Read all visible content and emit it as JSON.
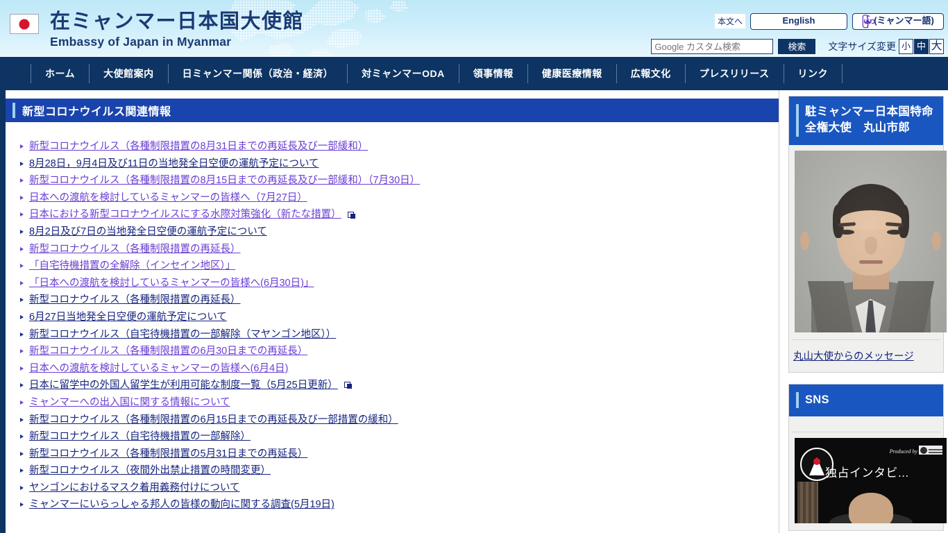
{
  "header": {
    "title_jp": "在ミャンマー日本国大使館",
    "title_en": "Embassy of Japan in Myanmar",
    "flag_icon": "japan-flag-icon",
    "skip_link": "本文へ",
    "lang_english": "English",
    "lang_myanmar_native": "မြန်မာ",
    "lang_myanmar_jp": "(ミャンマー語)",
    "search_placeholder": "Google カスタム検索",
    "search_value": "",
    "search_button": "検索",
    "fontsize_label": "文字サイズ変更",
    "fontsize_options": [
      "小",
      "中",
      "大"
    ],
    "fontsize_selected": "中",
    "bg_gradient_top": "#bfe8f7",
    "bg_gradient_bottom": "#e8f7fd",
    "title_color": "#1b3a73"
  },
  "nav": {
    "bg_color": "#0d3462",
    "items": [
      {
        "label": "ホーム"
      },
      {
        "label": "大使館案内"
      },
      {
        "label": "日ミャンマー関係（政治・経済）"
      },
      {
        "label": "対ミャンマーODA"
      },
      {
        "label": "領事情報"
      },
      {
        "label": "健康医療情報"
      },
      {
        "label": "広報文化"
      },
      {
        "label": "プレスリリース"
      },
      {
        "label": "リンク"
      }
    ]
  },
  "main": {
    "heading": "新型コロナウイルス関連情報",
    "heading_bg": "#1a44ad",
    "heading_accent": "#9fd2f2",
    "links": [
      {
        "label": "新型コロナウイルス（各種制限措置の8月31日までの再延長及び一部緩和）",
        "style": "unvisited",
        "external": false
      },
      {
        "label": "8月28日，9月4日及び11日の当地発全日空便の運航予定について",
        "style": "visited",
        "external": false
      },
      {
        "label": "新型コロナウイルス（各種制限措置の8月15日までの再延長及び一部緩和）（7月30日）",
        "style": "unvisited",
        "external": false
      },
      {
        "label": "日本への渡航を検討しているミャンマーの皆様へ（7月27日）",
        "style": "unvisited",
        "external": false
      },
      {
        "label": "日本における新型コロナウイルスにする水際対策強化（新たな措置）",
        "style": "unvisited",
        "external": true
      },
      {
        "label": "8月2日及び7日の当地発全日空便の運航予定について",
        "style": "visited",
        "external": false
      },
      {
        "label": "新型コロナウイルス（各種制限措置の再延長）",
        "style": "unvisited",
        "external": false
      },
      {
        "label": "「自宅待機措置の全解除（インセイン地区）」",
        "style": "unvisited",
        "external": false
      },
      {
        "label": "「日本への渡航を検討しているミャンマーの皆様へ(6月30日)」",
        "style": "unvisited",
        "external": false
      },
      {
        "label": "新型コロナウイルス（各種制限措置の再延長）",
        "style": "visited",
        "external": false
      },
      {
        "label": "6月27日当地発全日空便の運航予定について",
        "style": "visited",
        "external": false
      },
      {
        "label": "新型コロナウイルス（自宅待機措置の一部解除（マヤンゴン地区））",
        "style": "visited",
        "external": false
      },
      {
        "label": "新型コロナウイルス（各種制限措置の6月30日までの再延長）",
        "style": "unvisited",
        "external": false
      },
      {
        "label": "日本への渡航を検討しているミャンマーの皆様へ(6月4日)",
        "style": "unvisited",
        "external": false
      },
      {
        "label": "日本に留学中の外国人留学生が利用可能な制度一覧（5月25日更新）",
        "style": "visited",
        "external": true
      },
      {
        "label": "ミャンマーへの出入国に関する情報について",
        "style": "unvisited",
        "external": false
      },
      {
        "label": "新型コロナウイルス（各種制限措置の6月15日までの再延長及び一部措置の緩和）",
        "style": "visited",
        "external": false
      },
      {
        "label": "新型コロナウイルス（自宅待機措置の一部解除）",
        "style": "visited",
        "external": false
      },
      {
        "label": "新型コロナウイルス（各種制限措置の5月31日までの再延長）",
        "style": "visited",
        "external": false
      },
      {
        "label": "新型コロナウイルス（夜間外出禁止措置の時間変更）",
        "style": "visited",
        "external": false
      },
      {
        "label": "ヤンゴンにおけるマスク着用義務付けについて",
        "style": "visited",
        "external": false
      },
      {
        "label": "ミャンマーにいらっしゃる邦人の皆様の動向に関する調査(5月19日)",
        "style": "visited",
        "external": false
      }
    ]
  },
  "sidebar": {
    "ambassador_card": {
      "heading": "駐ミャンマー日本国特命全権大使　丸山市郎",
      "photo_alt": "ambassador-portrait",
      "message_link": "丸山大使からのメッセージ",
      "heading_bg": "#1a56c0"
    },
    "sns_card": {
      "heading": "SNS",
      "video_title": "独占インタビ...",
      "video_produced_by": "Produced by"
    }
  }
}
